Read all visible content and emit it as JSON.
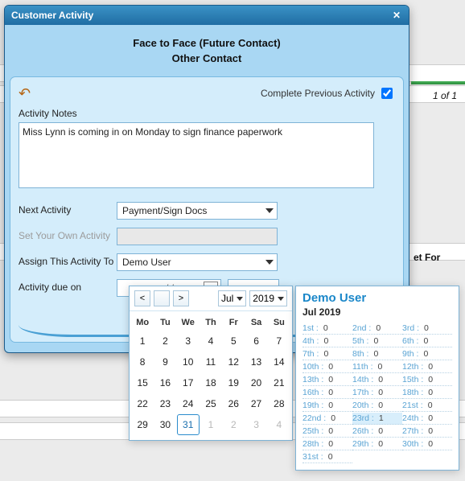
{
  "bg": {
    "pager": "1 of 1",
    "setFor": "et For"
  },
  "dialog": {
    "title": "Customer Activity",
    "subtitle1": "Face to Face (Future Contact)",
    "subtitle2": "Other Contact",
    "completePrev": "Complete Previous Activity",
    "notesLabel": "Activity Notes",
    "notesValue": "Miss Lynn is coming in on Monday to sign finance paperwork",
    "nextActivityLabel": "Next Activity",
    "nextActivityValue": "Payment/Sign Docs",
    "ownActivityLabel": "Set Your Own Activity",
    "assignLabel": "Assign This Activity To",
    "assignValue": "Demo User",
    "dueLabel": "Activity due on",
    "dueDateValue": "/          /",
    "dueTimeValue": ""
  },
  "calendar": {
    "month": "Jul",
    "year": "2019",
    "dow": [
      "Mo",
      "Tu",
      "We",
      "Th",
      "Fr",
      "Sa",
      "Su"
    ],
    "days": [
      {
        "n": "1"
      },
      {
        "n": "2"
      },
      {
        "n": "3"
      },
      {
        "n": "4"
      },
      {
        "n": "5"
      },
      {
        "n": "6"
      },
      {
        "n": "7"
      },
      {
        "n": "8"
      },
      {
        "n": "9"
      },
      {
        "n": "10"
      },
      {
        "n": "11"
      },
      {
        "n": "12"
      },
      {
        "n": "13"
      },
      {
        "n": "14"
      },
      {
        "n": "15"
      },
      {
        "n": "16"
      },
      {
        "n": "17"
      },
      {
        "n": "18"
      },
      {
        "n": "19"
      },
      {
        "n": "20"
      },
      {
        "n": "21"
      },
      {
        "n": "22"
      },
      {
        "n": "23"
      },
      {
        "n": "24"
      },
      {
        "n": "25"
      },
      {
        "n": "26"
      },
      {
        "n": "27"
      },
      {
        "n": "28"
      },
      {
        "n": "29"
      },
      {
        "n": "30"
      },
      {
        "n": "31",
        "sel": true
      },
      {
        "n": "1",
        "o": true
      },
      {
        "n": "2",
        "o": true
      },
      {
        "n": "3",
        "o": true
      },
      {
        "n": "4",
        "o": true
      }
    ]
  },
  "avail": {
    "user": "Demo User",
    "month": "Jul 2019",
    "days": [
      {
        "ord": "1st :",
        "cnt": "0"
      },
      {
        "ord": "2nd :",
        "cnt": "0"
      },
      {
        "ord": "3rd :",
        "cnt": "0"
      },
      {
        "ord": "4th :",
        "cnt": "0"
      },
      {
        "ord": "5th :",
        "cnt": "0"
      },
      {
        "ord": "6th :",
        "cnt": "0"
      },
      {
        "ord": "7th :",
        "cnt": "0"
      },
      {
        "ord": "8th :",
        "cnt": "0"
      },
      {
        "ord": "9th :",
        "cnt": "0"
      },
      {
        "ord": "10th :",
        "cnt": "0"
      },
      {
        "ord": "11th :",
        "cnt": "0"
      },
      {
        "ord": "12th :",
        "cnt": "0"
      },
      {
        "ord": "13th :",
        "cnt": "0"
      },
      {
        "ord": "14th :",
        "cnt": "0"
      },
      {
        "ord": "15th :",
        "cnt": "0"
      },
      {
        "ord": "16th :",
        "cnt": "0"
      },
      {
        "ord": "17th :",
        "cnt": "0"
      },
      {
        "ord": "18th :",
        "cnt": "0"
      },
      {
        "ord": "19th :",
        "cnt": "0"
      },
      {
        "ord": "20th :",
        "cnt": "0"
      },
      {
        "ord": "21st :",
        "cnt": "0"
      },
      {
        "ord": "22nd :",
        "cnt": "0"
      },
      {
        "ord": "23rd :",
        "cnt": "1",
        "hl": true
      },
      {
        "ord": "24th :",
        "cnt": "0"
      },
      {
        "ord": "25th :",
        "cnt": "0"
      },
      {
        "ord": "26th :",
        "cnt": "0"
      },
      {
        "ord": "27th :",
        "cnt": "0"
      },
      {
        "ord": "28th :",
        "cnt": "0"
      },
      {
        "ord": "29th :",
        "cnt": "0"
      },
      {
        "ord": "30th :",
        "cnt": "0"
      },
      {
        "ord": "31st :",
        "cnt": "0"
      }
    ]
  }
}
